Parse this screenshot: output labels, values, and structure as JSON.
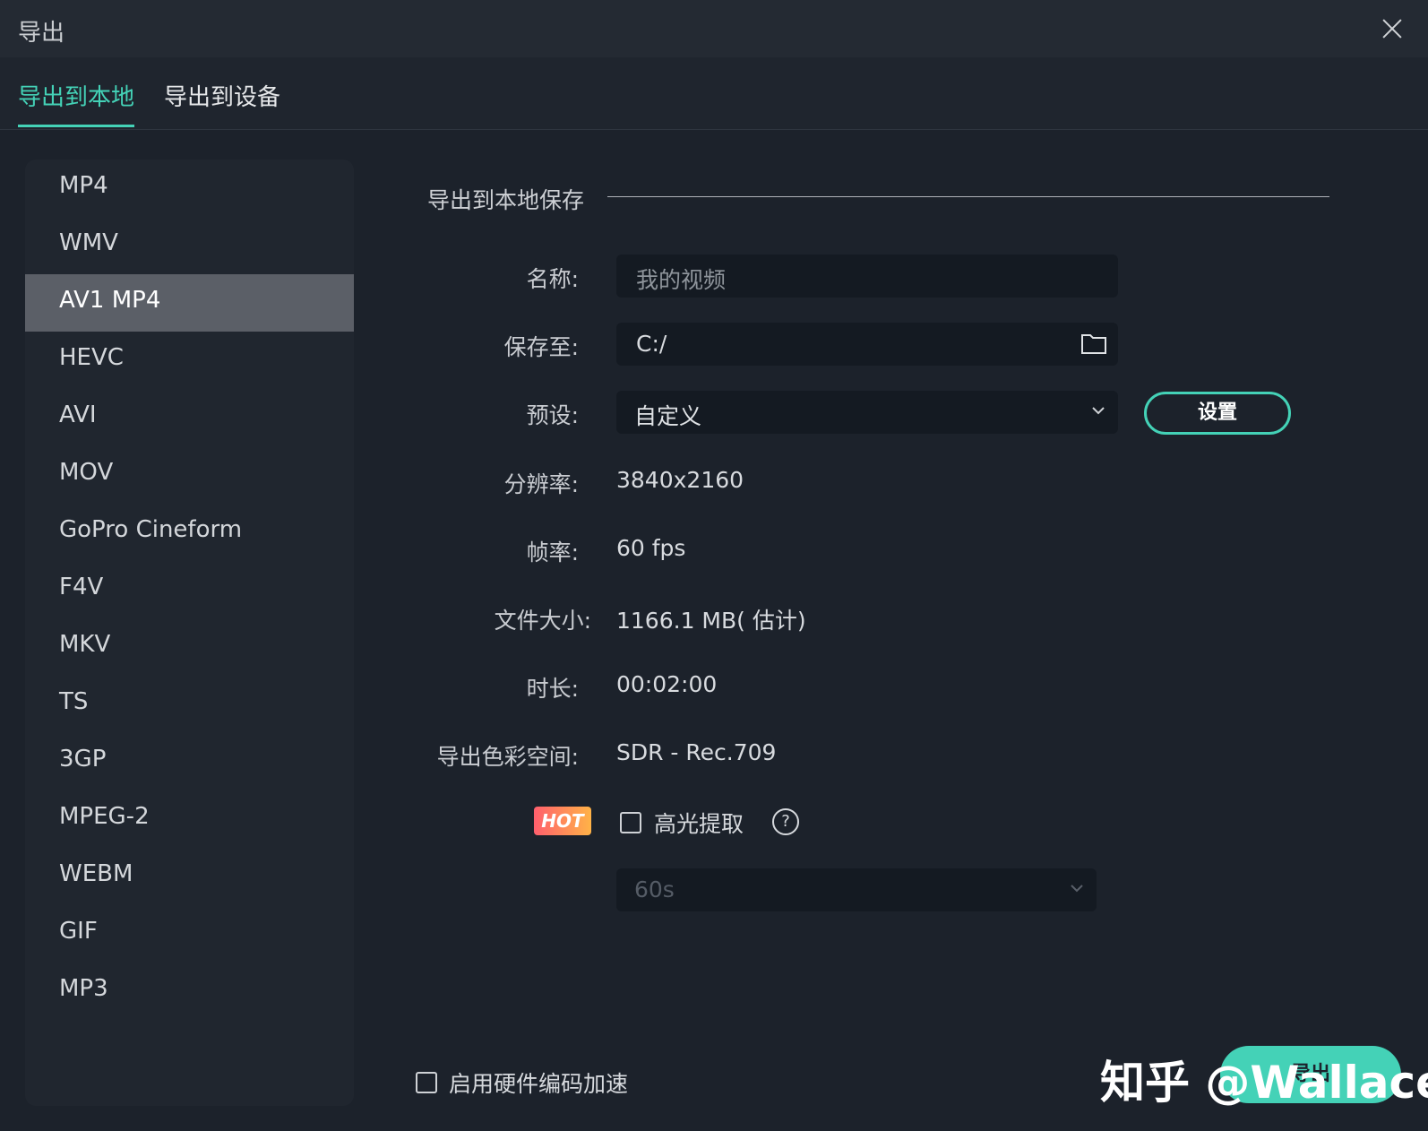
{
  "window": {
    "title": "导出",
    "close_label": "close"
  },
  "tabs": [
    {
      "label": "导出到本地"
    },
    {
      "label": "导出到设备"
    }
  ],
  "formats": [
    "MP4",
    "WMV",
    "AV1 MP4",
    "HEVC",
    "AVI",
    "MOV",
    "GoPro Cineform",
    "F4V",
    "MKV",
    "TS",
    "3GP",
    "MPEG-2",
    "WEBM",
    "GIF",
    "MP3"
  ],
  "selected_format": "AV1 MP4",
  "section": {
    "title": "导出到本地保存"
  },
  "form": {
    "name_label": "名称:",
    "name_value": "我的视频",
    "path_label": "保存至:",
    "path_value": "C:/",
    "preset_label": "预设:",
    "preset_value": "自定义",
    "settings_button": "设置",
    "resolution_label": "分辨率:",
    "resolution_value": "3840x2160",
    "fps_label": "帧率:",
    "fps_value": "60 fps",
    "size_label": "文件大小:",
    "size_value": "1166.1 MB( 估计)",
    "duration_label": "时长:",
    "duration_value": "00:02:00",
    "color_label": "导出色彩空间:",
    "color_value": "SDR - Rec.709",
    "hot_badge": "HOT",
    "highlight_label": "高光提取",
    "highlight_help": "?",
    "highlight_duration": "60s"
  },
  "footer": {
    "hw_accel_label": "启用硬件编码加速",
    "export_button": "导出",
    "watermark": "知乎 @Wallace"
  },
  "colors": {
    "accent": "#44d2b7",
    "background": "#1c222b"
  }
}
